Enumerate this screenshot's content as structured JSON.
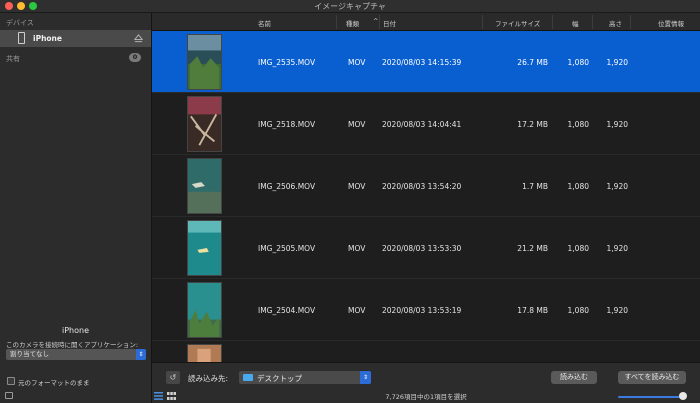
{
  "window": {
    "title": "イメージキャプチャ"
  },
  "sidebar": {
    "devices_header": "デバイス",
    "device_name": "iPhone",
    "shared_header": "共有",
    "shared_count": "0",
    "device_panel_title": "iPhone",
    "open_app_label": "このカメラを接続時に開くアプリケーション:",
    "open_app_value": "割り当てなし",
    "keep_format_label": "元のフォーマットのまま"
  },
  "columns": {
    "name": "名前",
    "kind": "種類",
    "date": "日付",
    "size": "ファイルサイズ",
    "width": "幅",
    "height": "高さ",
    "location": "位置情報"
  },
  "rows": [
    {
      "name": "IMG_2535.MOV",
      "kind": "MOV",
      "date": "2020/08/03 14:15:39",
      "size": "26.7 MB",
      "width": "1,080",
      "height": "1,920",
      "selected": true
    },
    {
      "name": "IMG_2518.MOV",
      "kind": "MOV",
      "date": "2020/08/03 14:04:41",
      "size": "17.2 MB",
      "width": "1,080",
      "height": "1,920",
      "selected": false
    },
    {
      "name": "IMG_2506.MOV",
      "kind": "MOV",
      "date": "2020/08/03 13:54:20",
      "size": "1.7 MB",
      "width": "1,080",
      "height": "1,920",
      "selected": false
    },
    {
      "name": "IMG_2505.MOV",
      "kind": "MOV",
      "date": "2020/08/03 13:53:30",
      "size": "21.2 MB",
      "width": "1,080",
      "height": "1,920",
      "selected": false
    },
    {
      "name": "IMG_2504.MOV",
      "kind": "MOV",
      "date": "2020/08/03 13:53:19",
      "size": "17.8 MB",
      "width": "1,080",
      "height": "1,920",
      "selected": false
    }
  ],
  "bottom": {
    "import_to_label": "読み込み先:",
    "destination": "デスクトップ",
    "import_button": "読み込む",
    "import_all_button": "すべてを読み込む",
    "status": "7,726項目中の1項目を選択"
  },
  "colors": {
    "selection": "#0a5fd0",
    "accent": "#2b6cd6"
  }
}
